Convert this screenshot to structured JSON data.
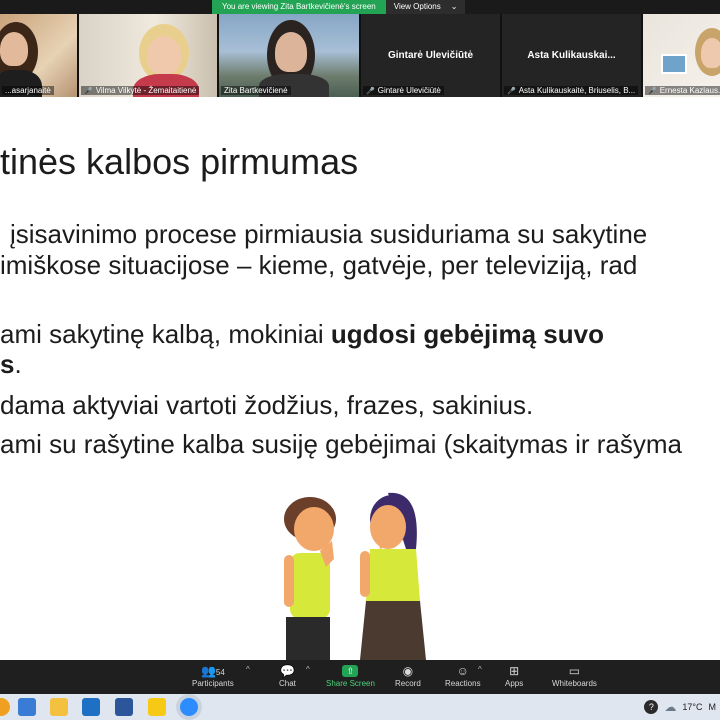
{
  "banner": {
    "viewing_text": "You are viewing Zita Bartkevičienė's screen",
    "view_options": "View Options",
    "view_options_caret": "⌄"
  },
  "participants": [
    {
      "name": "...asarjanaitė",
      "display": "video",
      "muted": false
    },
    {
      "name": "Vilma Vilkytė - Žemaitaitienė",
      "display": "video",
      "muted": true
    },
    {
      "name": "Zita Bartkevičienė",
      "display": "video",
      "muted": false
    },
    {
      "name": "Gintarė Ulevičiūtė",
      "display": "name",
      "center_name": "Gintarė Ulevičiūtė",
      "muted": true
    },
    {
      "name": "Asta Kulikauskaitė, Briuselis, B...",
      "display": "name",
      "center_name": "Asta  Kulikauskai...",
      "muted": true
    },
    {
      "name": "Ernesta Kazlaus...",
      "display": "video",
      "muted": true
    }
  ],
  "slide": {
    "title": "tinės kalbos pirmumas",
    "lines": [
      {
        "text": "įsisavinimo procese pirmiausia susiduriama su sakytine"
      },
      {
        "text": "imiškose situacijose – kieme, gatvėje, per televiziją, rad"
      },
      {
        "pre": "ami sakytinę kalbą, mokiniai ",
        "bold": "ugdosi gebėjimą suvo"
      },
      {
        "bold": "s",
        "post": "."
      },
      {
        "text": "dama aktyviai vartoti žodžius, frazes, sakinius."
      },
      {
        "text": "ami su rašytine kalba susiję gebėjimai (skaitymas ir rašyma"
      }
    ]
  },
  "toolbar": {
    "participants_count": "54",
    "participants_label": "Participants",
    "chat_label": "Chat",
    "share_label": "Share Screen",
    "record_label": "Record",
    "reactions_label": "Reactions",
    "apps_label": "Apps",
    "whiteboards_label": "Whiteboards"
  },
  "taskbar": {
    "temperature": "17°C",
    "tray_text": "M"
  },
  "colors": {
    "share_green": "#23a454",
    "banner_green": "#23a454",
    "slide_bg": "#ffffff",
    "toolbar_bg": "#1f1f1f"
  }
}
